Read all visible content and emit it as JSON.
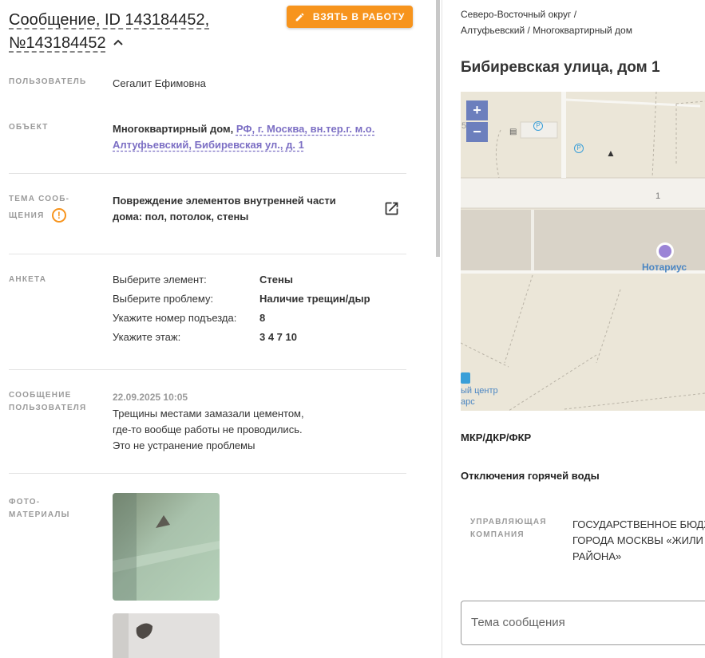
{
  "message": {
    "title_line1": "Сообщение, ID 143184452,",
    "title_line2": "№143184452",
    "take_button": "ВЗЯТЬ В РАБОТУ"
  },
  "fields": {
    "user_label": "ПОЛЬЗОВАТЕЛЬ",
    "user_value": "Сегалит Ефимовна",
    "object_label": "ОБЪЕКТ",
    "object_type": "Многоквартирный дом,",
    "object_addr_line1": "РФ, г. Москва, вн.тер.г. м.о.",
    "object_addr_line2": "Алтуфьевский, Бибиревская ул., д. 1",
    "topic_label_line1": "ТЕМА СООБ-",
    "topic_label_line2": "ЩЕНИЯ",
    "topic_line1": "Повреждение элементов внутренней части",
    "topic_line2": "дома: пол, потолок, стены",
    "anketa_label": "АНКЕТА",
    "anketa": [
      {
        "key": "Выберите элемент:",
        "value": "Стены"
      },
      {
        "key": "Выберите проблему:",
        "value": "Наличие трещин/дыр"
      },
      {
        "key": "Укажите номер подъезда:",
        "value": "8"
      },
      {
        "key": "Укажите этаж:",
        "value": "3 4 7 10"
      }
    ],
    "user_msg_label_line1": "СООБЩЕНИЕ",
    "user_msg_label_line2": "ПОЛЬЗОВАТЕЛЯ",
    "user_msg_date": "22.09.2025 10:05",
    "user_msg_line1": "Трещины местами замазали цементом,",
    "user_msg_line2": "где-то вообще работы не проводились.",
    "user_msg_line3": "Это не устранение проблемы",
    "photos_label_line1": "ФОТО-",
    "photos_label_line2": "МАТЕРИАЛЫ"
  },
  "right": {
    "crumb_line1": "Северо-Восточный округ /",
    "crumb_line2": "Алтуфьевский / Многоквартирный дом",
    "address": "Бибиревская улица, дом 1",
    "map": {
      "zoom_in": "+",
      "zoom_out": "−",
      "edge_number": "5",
      "parking_1": "P",
      "parking_2": "P",
      "building_number": "1",
      "poi_label": "Нотариус",
      "bottom_label_1": "ый центр",
      "bottom_label_2": "арс"
    },
    "housing_type": "МКР/ДКР/ФКР",
    "hot_water": "Отключения горячей воды",
    "company_label_line1": "УПРАВЛЯЮЩАЯ",
    "company_label_line2": "КОМПАНИЯ",
    "company_line1": "ГОСУДАРСТВЕННОЕ БЮДЖ",
    "company_line2": "ГОРОДА МОСКВЫ «ЖИЛИ",
    "company_line3": "РАЙОНА»",
    "subject_placeholder": "Тема сообщения"
  },
  "colors": {
    "accent_orange": "#f7941d",
    "link_purple": "#7c6fc4",
    "map_background": "#ebe6d8"
  }
}
